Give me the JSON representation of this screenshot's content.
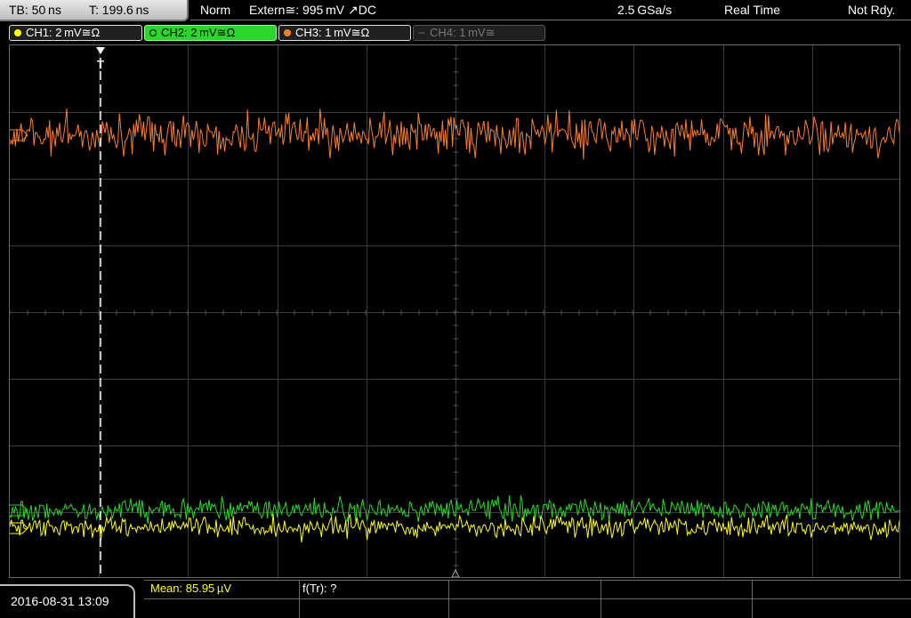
{
  "header": {
    "timebase": "TB: 50 ns",
    "trigger_time": "T: 199.6 ns",
    "mode": "Norm",
    "trigger": "Extern≅: 995 mV ↗DC",
    "sample_rate": "2.5 GSa/s",
    "acq_mode": "Real Time",
    "status": "Not Rdy."
  },
  "channels": [
    {
      "label": "CH1: 2 mV≅Ω",
      "color": "#ffff00",
      "active": true
    },
    {
      "label": "CH2: 2 mV≅Ω",
      "color": "#22dd22",
      "active": true
    },
    {
      "label": "CH3: 1 mV≅Ω",
      "color": "#ff7f1f",
      "active": true
    },
    {
      "label": "CH4: 1 mV≅",
      "color": "#555555",
      "active": false
    }
  ],
  "footer": {
    "datetime": "2016-08-31 13:09",
    "mean": "Mean: 85.95 µV",
    "freq": "f(Tr): ?"
  },
  "trigger_marker": "T",
  "colors": {
    "ch1": "#ffff00",
    "ch2": "#22dd22",
    "ch3": "#ff7f1f",
    "grid": "#3a3a3a"
  }
}
